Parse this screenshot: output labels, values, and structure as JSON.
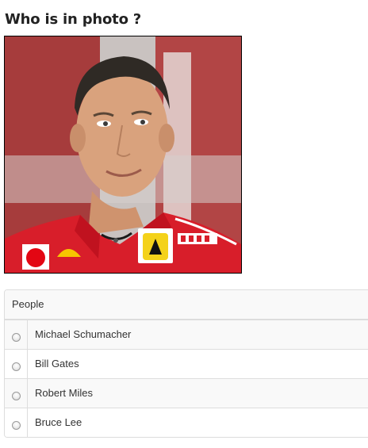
{
  "question": {
    "title": "Who is in photo ?"
  },
  "photo": {
    "description_icon": "portrait-photo",
    "colors": {
      "shirt": "#d81e2a",
      "background_red": "#a23a3a",
      "skin": "#d9a27d",
      "hair": "#2f2a25"
    }
  },
  "options_table": {
    "header": "People",
    "options": [
      {
        "label": "Michael Schumacher",
        "selected": false
      },
      {
        "label": "Bill Gates",
        "selected": false
      },
      {
        "label": "Robert Miles",
        "selected": false
      },
      {
        "label": "Bruce Lee",
        "selected": false
      }
    ]
  }
}
